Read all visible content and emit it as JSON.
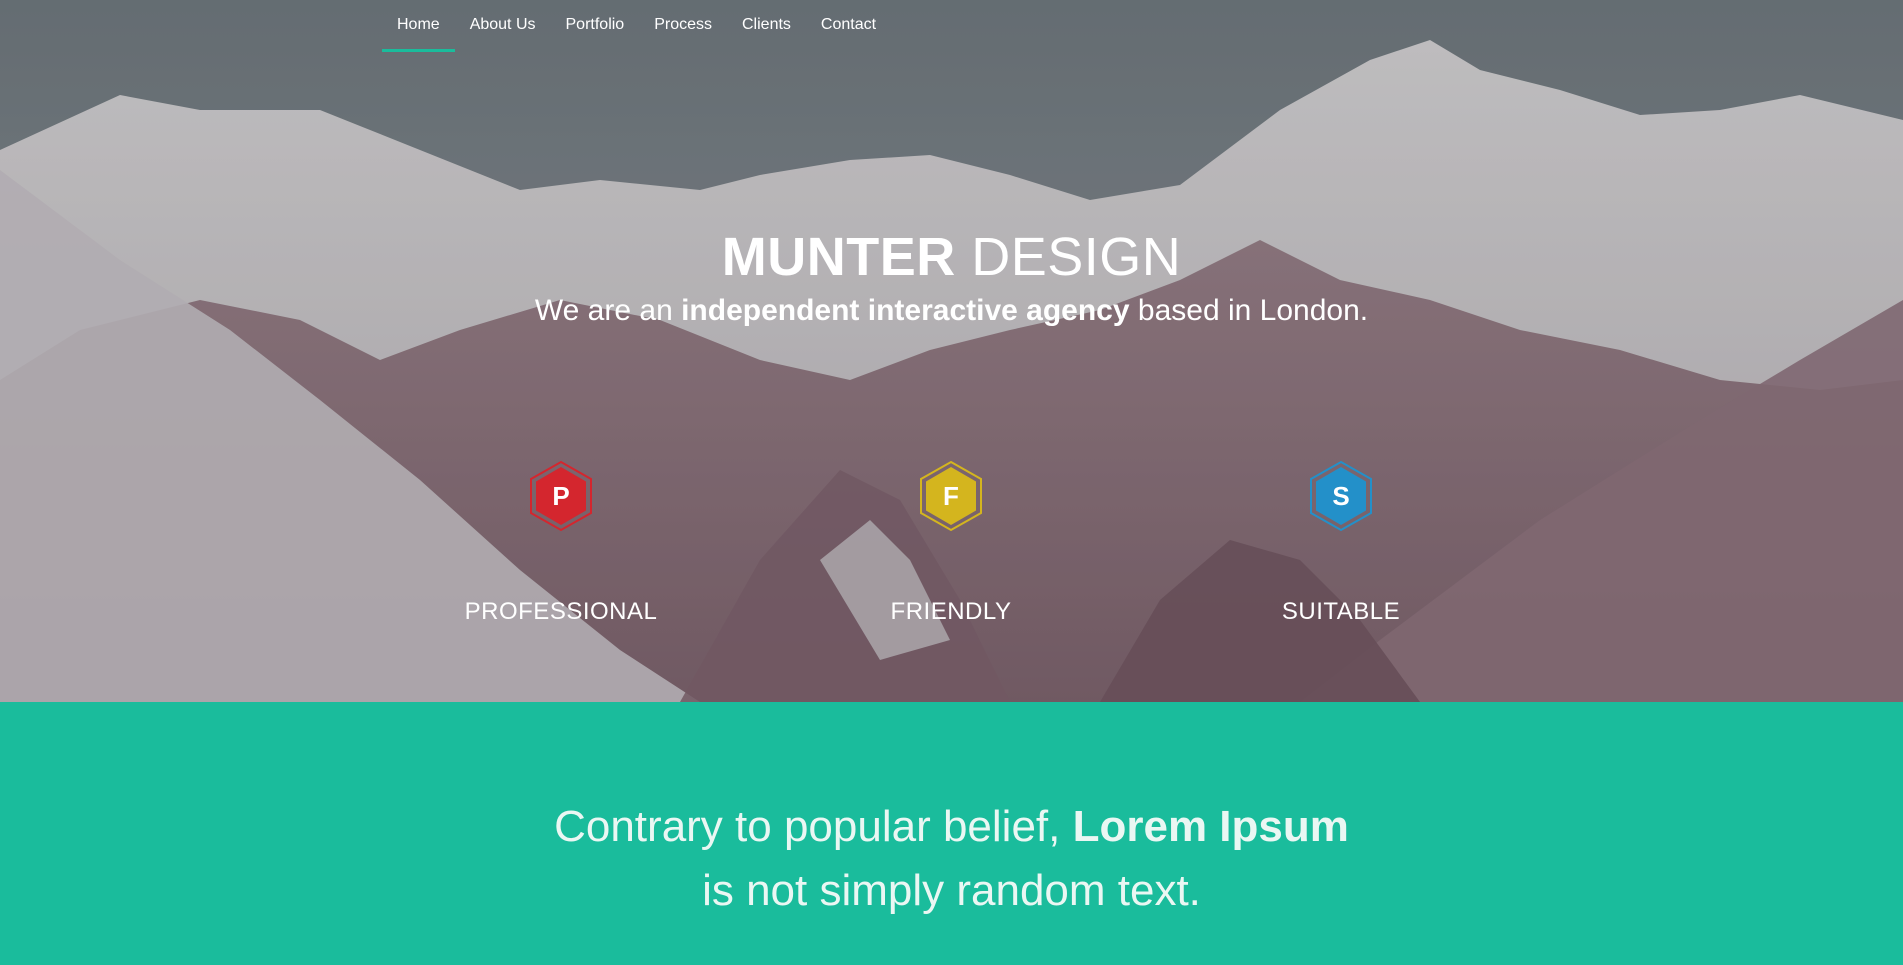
{
  "nav": {
    "items": [
      {
        "label": "Home",
        "active": true
      },
      {
        "label": "About Us",
        "active": false
      },
      {
        "label": "Portfolio",
        "active": false
      },
      {
        "label": "Process",
        "active": false
      },
      {
        "label": "Clients",
        "active": false
      },
      {
        "label": "Contact",
        "active": false
      }
    ]
  },
  "hero": {
    "title_bold": "MUNTER",
    "title_light": " DESIGN",
    "subtitle_pre": "We are an ",
    "subtitle_bold": "independent interactive agency",
    "subtitle_post": " based in London."
  },
  "features": [
    {
      "letter": "P",
      "label": "PROFESSIONAL",
      "color": "#d4262e",
      "icon": "hexagon-p-icon"
    },
    {
      "letter": "F",
      "label": "FRIENDLY",
      "color": "#d4b51e",
      "icon": "hexagon-f-icon"
    },
    {
      "letter": "S",
      "label": "SUITABLE",
      "color": "#2390c9",
      "icon": "hexagon-s-icon"
    }
  ],
  "quote": {
    "line1_pre": "Contrary to popular belief, ",
    "line1_bold": "Lorem Ipsum",
    "line2": "is not simply random text."
  },
  "colors": {
    "accent": "#1abc9c"
  }
}
